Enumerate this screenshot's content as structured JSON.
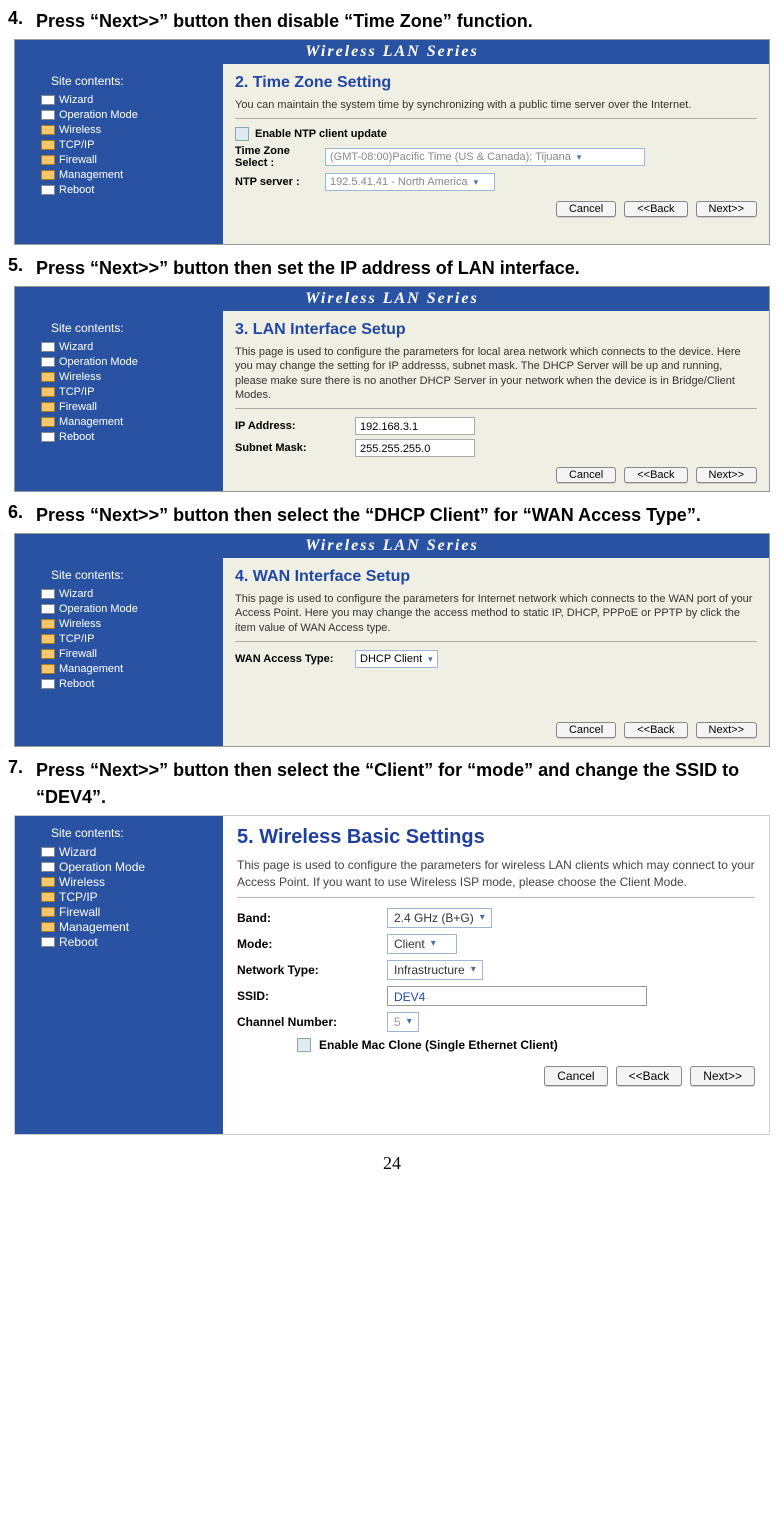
{
  "common": {
    "titlebar": "Wireless LAN Series",
    "sidebar_title": "Site contents:",
    "menu": {
      "wizard": "Wizard",
      "opmode": "Operation Mode",
      "wireless": "Wireless",
      "tcpip": "TCP/IP",
      "firewall": "Firewall",
      "management": "Management",
      "reboot": "Reboot"
    },
    "buttons": {
      "cancel": "Cancel",
      "back": "<<Back",
      "next": "Next>>"
    }
  },
  "steps": {
    "s4": {
      "num": "4.",
      "text": "Press “Next>>” button then disable “Time Zone” function."
    },
    "s5": {
      "num": "5.",
      "text": "Press “Next>>” button then set the IP address of LAN interface."
    },
    "s6": {
      "num": "6.",
      "text": "Press “Next>>” button then select the “DHCP Client” for “WAN Access Type”."
    },
    "s7": {
      "num": "7.",
      "text": "Press “Next>>” button then select the “Client” for “mode” and change the SSID to “DEV4”."
    }
  },
  "panel2": {
    "title": "2. Time Zone Setting",
    "desc": "You can maintain the system time by synchronizing with a public time server over the Internet.",
    "ntp_enable": "Enable NTP client update",
    "tz_label": "Time Zone Select :",
    "tz_value": "(GMT-08:00)Pacific Time (US & Canada); Tijuana",
    "ntp_label": "NTP server :",
    "ntp_value": "192.5.41.41 - North America"
  },
  "panel3": {
    "title": "3. LAN Interface Setup",
    "desc": "This page is used to configure the parameters for local area network which connects to the device. Here you may change the setting for IP addresss, subnet mask. The DHCP Server will be up and running, please make sure there is no another DHCP Server in your network when the device is in Bridge/Client Modes.",
    "ip_label": "IP Address:",
    "ip_value": "192.168.3.1",
    "mask_label": "Subnet Mask:",
    "mask_value": "255.255.255.0"
  },
  "panel4": {
    "title": "4. WAN Interface Setup",
    "desc": "This page is used to configure the parameters for Internet network which connects to the WAN port of your Access Point. Here you may change the access method to static IP, DHCP, PPPoE or PPTP by click the item value of WAN Access type.",
    "wan_label": "WAN Access Type:",
    "wan_value": "DHCP Client"
  },
  "panel5": {
    "title": "5. Wireless Basic Settings",
    "desc": "This page is used to configure the parameters for wireless LAN clients which may connect to your Access Point. If you want to use Wireless ISP mode, please choose the Client Mode.",
    "band_label": "Band:",
    "band_value": "2.4 GHz (B+G)",
    "mode_label": "Mode:",
    "mode_value": "Client",
    "nettype_label": "Network Type:",
    "nettype_value": "Infrastructure",
    "ssid_label": "SSID:",
    "ssid_value": "DEV4",
    "chan_label": "Channel Number:",
    "chan_value": "5",
    "macclone": "Enable Mac Clone (Single Ethernet Client)"
  },
  "page_number": "24"
}
